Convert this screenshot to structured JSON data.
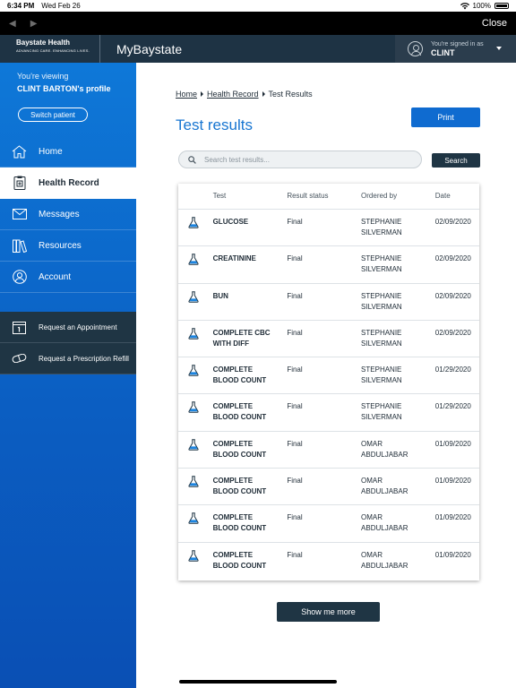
{
  "status_bar": {
    "time": "6:34 PM",
    "date": "Wed Feb 26",
    "battery": "100%"
  },
  "browser_bar": {
    "close_label": "Close"
  },
  "header": {
    "logo_text": "Baystate Health",
    "logo_tagline": "ADVANCING CARE. ENHANCING LIVES.",
    "app_title": "MyBaystate",
    "signed_in_label": "You're signed in as",
    "signed_in_name": "CLINT"
  },
  "sidebar": {
    "viewing_label": "You're viewing",
    "viewing_name": "CLINT BARTON's profile",
    "switch_label": "Switch patient",
    "items": [
      {
        "label": "Home",
        "icon": "home-icon",
        "active": false
      },
      {
        "label": "Health Record",
        "icon": "health-record-icon",
        "active": true
      },
      {
        "label": "Messages",
        "icon": "envelope-icon",
        "active": false
      },
      {
        "label": "Resources",
        "icon": "books-icon",
        "active": false
      },
      {
        "label": "Account",
        "icon": "user-icon",
        "active": false
      }
    ],
    "quick_links": [
      {
        "label": "Request an Appointment",
        "icon": "calendar-icon"
      },
      {
        "label": "Request a Prescription Refill",
        "icon": "pill-icon"
      }
    ]
  },
  "main": {
    "breadcrumb": [
      "Home",
      "Health Record",
      "Test Results"
    ],
    "title": "Test results",
    "print_label": "Print",
    "search_placeholder": "Search test results...",
    "search_label": "Search",
    "more_label": "Show me more",
    "table": {
      "headers": [
        "Test",
        "Result status",
        "Ordered by",
        "Date"
      ],
      "rows": [
        {
          "test": [
            "GLUCOSE"
          ],
          "status": "Final",
          "ordered": [
            "STEPHANIE",
            "SILVERMAN"
          ],
          "date": "02/09/2020"
        },
        {
          "test": [
            "CREATININE"
          ],
          "status": "Final",
          "ordered": [
            "STEPHANIE",
            "SILVERMAN"
          ],
          "date": "02/09/2020"
        },
        {
          "test": [
            "BUN"
          ],
          "status": "Final",
          "ordered": [
            "STEPHANIE",
            "SILVERMAN"
          ],
          "date": "02/09/2020"
        },
        {
          "test": [
            "COMPLETE CBC",
            "WITH DIFF"
          ],
          "status": "Final",
          "ordered": [
            "STEPHANIE",
            "SILVERMAN"
          ],
          "date": "02/09/2020"
        },
        {
          "test": [
            "COMPLETE",
            "BLOOD COUNT"
          ],
          "status": "Final",
          "ordered": [
            "STEPHANIE",
            "SILVERMAN"
          ],
          "date": "01/29/2020"
        },
        {
          "test": [
            "COMPLETE",
            "BLOOD COUNT"
          ],
          "status": "Final",
          "ordered": [
            "STEPHANIE",
            "SILVERMAN"
          ],
          "date": "01/29/2020"
        },
        {
          "test": [
            "COMPLETE",
            "BLOOD COUNT"
          ],
          "status": "Final",
          "ordered": [
            "OMAR",
            "ABDULJABAR"
          ],
          "date": "01/09/2020"
        },
        {
          "test": [
            "COMPLETE",
            "BLOOD COUNT"
          ],
          "status": "Final",
          "ordered": [
            "OMAR",
            "ABDULJABAR"
          ],
          "date": "01/09/2020"
        },
        {
          "test": [
            "COMPLETE",
            "BLOOD COUNT"
          ],
          "status": "Final",
          "ordered": [
            "OMAR",
            "ABDULJABAR"
          ],
          "date": "01/09/2020"
        },
        {
          "test": [
            "COMPLETE",
            "BLOOD COUNT"
          ],
          "status": "Final",
          "ordered": [
            "OMAR",
            "ABDULJABAR"
          ],
          "date": "01/09/2020"
        }
      ]
    }
  },
  "colors": {
    "accent": "#0f6bd0",
    "sidebar": "#0b5ec2",
    "header": "#1e3344",
    "dark_button": "#1f3544"
  }
}
